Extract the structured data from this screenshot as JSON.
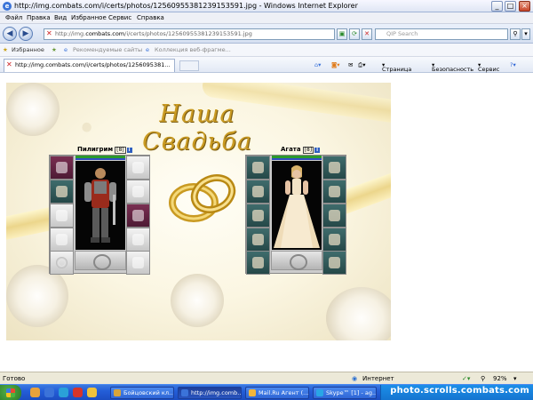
{
  "window": {
    "title": "http://img.combats.com/i/certs/photos/1256095538123915359​1.jpg - Windows Internet Explorer"
  },
  "menu": {
    "items": [
      "Файл",
      "Правка",
      "Вид",
      "Избранное",
      "Сервис",
      "Справка"
    ]
  },
  "address": {
    "prefix": "http://img.",
    "domain": "combats.com",
    "suffix": "/i/certs/photos/12560955381239153591.jpg"
  },
  "search": {
    "placeholder": "QIP Search"
  },
  "favorites": {
    "label": "Избранное",
    "suggested": "Рекомендуемые сайты",
    "gallery": "Коллекция веб-фрагме..."
  },
  "tab": {
    "label": "http://img.combats.com/i/certs/photos/1256095381..."
  },
  "toolbar": {
    "page": "Страница",
    "safety": "Безопасность",
    "service": "Сервис"
  },
  "photo": {
    "heading": "Наша Свадьба",
    "left": {
      "name": "Пилигрим",
      "level": "8",
      "info": "i"
    },
    "right": {
      "name": "Агата",
      "level": "8",
      "info": "i"
    }
  },
  "status": {
    "left": "Готово",
    "zone": "Интернет",
    "zoom": "92%"
  },
  "taskbar": {
    "tasks": [
      "Бойцовский кл...",
      "http://img.comb...",
      "Mail.Ru Агент (...",
      "Skype™ [1] - ag..."
    ],
    "watermark": "photo.scrolls.combats.com"
  },
  "colors": {
    "hp": "#2c9a2c",
    "mp": "#2f4ec0",
    "heading": "#c99a22",
    "taskbar": "#245ed8"
  }
}
